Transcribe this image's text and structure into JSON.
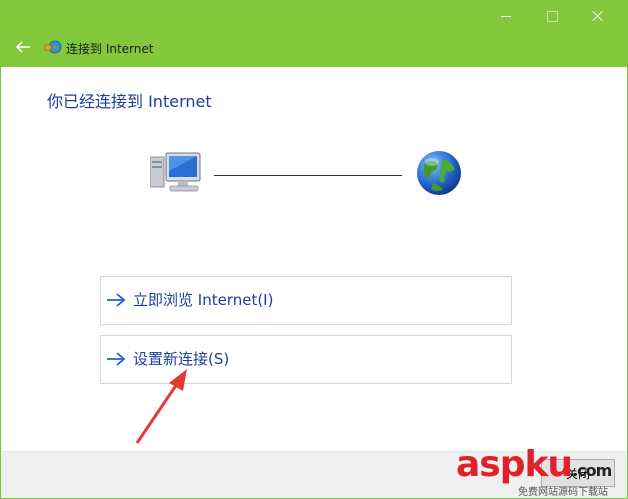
{
  "window": {
    "title": "连接到 Internet",
    "controls": {
      "minimize": "minimize",
      "maximize": "maximize",
      "close": "close"
    }
  },
  "heading": "你已经连接到 Internet",
  "options": [
    {
      "arrow": "arrow-right-icon",
      "label": "立即浏览 Internet(I)"
    },
    {
      "arrow": "arrow-right-icon",
      "label": "设置新连接(S)"
    }
  ],
  "footer": {
    "button_label": "关闭"
  },
  "watermark": {
    "brand": "aspku",
    "tld": ".com",
    "subtitle": "免费网站源码下载站"
  },
  "colors": {
    "accent": "#82c83a",
    "link": "#1f3d9b",
    "annotation": "#e53935"
  }
}
